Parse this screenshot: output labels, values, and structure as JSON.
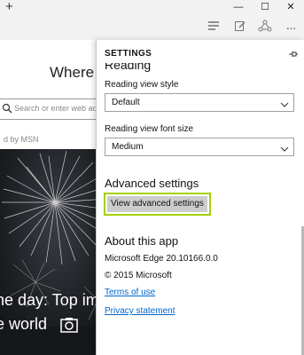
{
  "window": {
    "new_tab": "+",
    "minimize": "—",
    "maximize": "☐",
    "close": "✕"
  },
  "toolbar": {
    "hub_icon": "hub-icon",
    "note_icon": "web-note-icon",
    "share_icon": "share-icon",
    "more_label": "···"
  },
  "start_page": {
    "title": "Where t",
    "search_placeholder": "Search or enter web add",
    "powered_by": "d by MSN",
    "caption_line1": "he day: Top im",
    "caption_line2": "e world"
  },
  "settings": {
    "title": "SETTINGS",
    "cut_section": "Reading",
    "reading_view_style_label": "Reading view style",
    "reading_view_style_value": "Default",
    "reading_view_font_label": "Reading view font size",
    "reading_view_font_value": "Medium",
    "advanced_heading": "Advanced settings",
    "advanced_button": "View advanced settings",
    "about_heading": "About this app",
    "version": "Microsoft Edge 20.10166.0.0",
    "copyright": "© 2015 Microsoft",
    "terms_link": "Terms of use",
    "privacy_link": "Privacy statement"
  },
  "colors": {
    "focus_outline": "#a4d100",
    "link": "#0066cc",
    "button_bg": "#cccccc"
  }
}
